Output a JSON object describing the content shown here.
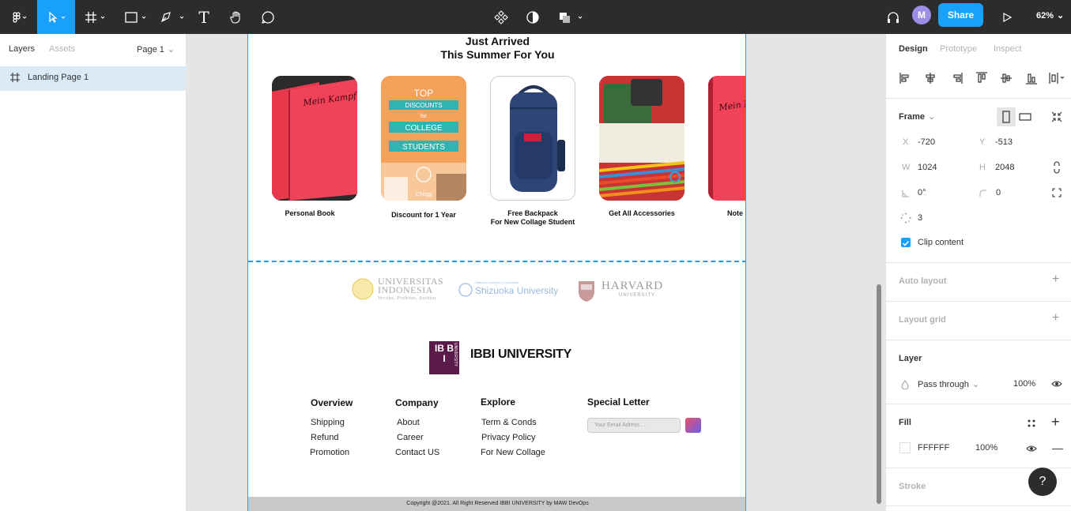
{
  "toolbar": {
    "share_label": "Share",
    "avatar_initial": "M",
    "zoom_label": "62%",
    "tool_text_glyph": "T"
  },
  "left_panel": {
    "tabs": [
      "Layers",
      "Assets"
    ],
    "page_selector": "Page 1",
    "layers": [
      {
        "name": "Landing Page 1",
        "type": "frame",
        "selected": true
      }
    ]
  },
  "landing": {
    "heading_line1": "Just Arrived",
    "heading_line2": "This Summer For You",
    "cards": [
      {
        "label": "Personal Book",
        "art_text": "Mein Kampf"
      },
      {
        "label": "Discount for 1 Year",
        "art_lines": [
          "TOP",
          "DISCOUNTS",
          "for",
          "COLLEGE",
          "STUDENTS",
          "Chegg"
        ]
      },
      {
        "label_line1": "Free Backpack",
        "label_line2": "For New Collage Student"
      },
      {
        "label": "Get All Accessories"
      },
      {
        "label": "Note",
        "art_text": "Mein Ka"
      }
    ],
    "partners": [
      {
        "line1": "UNIVERSITAS",
        "line2": "INDONESIA",
        "line3": "Veritas, Probitas, Iustitia"
      },
      {
        "line1": "National University Corporation",
        "line2": "Shizuoka University"
      },
      {
        "line1": "HARVARD",
        "line2": "UNIVERSITY"
      }
    ],
    "brand": {
      "logo_text": "IB BI",
      "logo_side": "UNIVERSITY",
      "name": "IBBI UNIVERSITY"
    },
    "footer": {
      "columns": [
        {
          "title": "Overview",
          "items": [
            "Shipping",
            "Refund",
            "Promotion"
          ]
        },
        {
          "title": "Company",
          "items": [
            "About",
            "Career",
            "Contact US"
          ]
        },
        {
          "title": "Explore",
          "items": [
            "Term & Conds",
            "Privacy Policy",
            "For New Collage"
          ]
        }
      ],
      "newsletter_title": "Special Letter",
      "email_placeholder": "Your Email Adress . . .",
      "copyright": "Copyright @2021. All Right Reserved IBBI UNIVERSITY by MAW DevOps"
    }
  },
  "right_panel": {
    "tabs": [
      "Design",
      "Prototype",
      "Inspect"
    ],
    "frame_label": "Frame",
    "x_label": "X",
    "x": "-720",
    "y_label": "Y",
    "y": "-513",
    "w_label": "W",
    "w": "1024",
    "h_label": "H",
    "h": "2048",
    "rotation": "0°",
    "radius": "0",
    "points": "3",
    "clip_content_label": "Clip content",
    "clip_content": true,
    "auto_layout_label": "Auto layout",
    "layout_grid_label": "Layout grid",
    "layer_label": "Layer",
    "blend_mode": "Pass through",
    "layer_opacity": "100%",
    "fill_label": "Fill",
    "fill_hex": "FFFFFF",
    "fill_opacity": "100%",
    "stroke_label": "Stroke"
  },
  "help_label": "?",
  "colors": {
    "accent": "#18a0fb",
    "toolbar": "#2c2c2c",
    "selection": "#daebf7",
    "brand": "#5a1a4a"
  }
}
